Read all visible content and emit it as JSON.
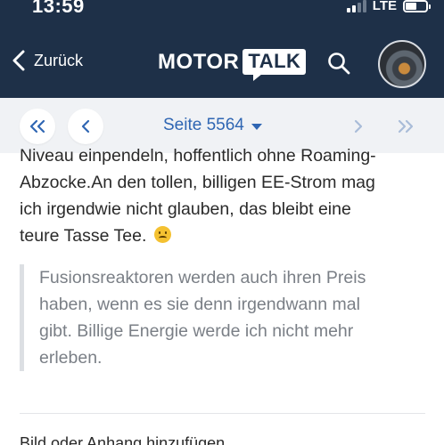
{
  "status_bar": {
    "time": "13:59",
    "network": "LTE",
    "signal_bars_active": 2,
    "signal_bars_total": 4,
    "battery_level": 0.55
  },
  "header": {
    "back_label": "Zurück",
    "logo_part1": "MOTOR",
    "logo_part2": "TALK",
    "background_color": "#1e3048",
    "icons": {
      "back": "chevron-left-icon",
      "search": "search-icon",
      "profile": "avatar"
    }
  },
  "pager": {
    "page_label": "Seite 5564",
    "accent_color": "#2f66b3",
    "buttons": [
      "first-page",
      "previous-page",
      "next-page",
      "last-page"
    ]
  },
  "post": {
    "lines": [
      "Niveau einpendeln, hoffentlich ohne Roaming-",
      "Abzocke.An den tollen, billigen EE-Strom mag",
      "ich irgendwie nicht glauben, das bleibt eine",
      "teure Tasse Tee."
    ],
    "emoji": "frowning-face-emoji"
  },
  "quote": {
    "lines": [
      "Fusionsreaktoren werden auch ihren Preis",
      "haben, wenn es sie denn irgendwann mal",
      "gibt. Billige Energie werde ich nicht mehr",
      "erleben."
    ]
  },
  "footer": {
    "attach_label": "Bild oder Anhang hinzufügen"
  }
}
